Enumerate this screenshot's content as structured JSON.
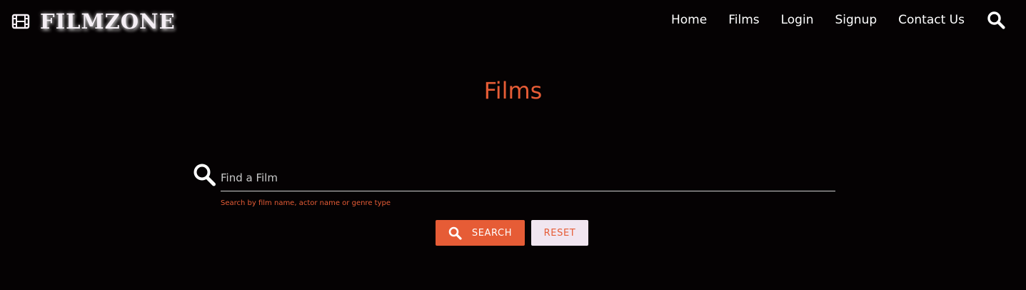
{
  "brand": {
    "name": "FILMZONE",
    "icon": "film-icon"
  },
  "nav": {
    "items": [
      "Home",
      "Films",
      "Login",
      "Signup",
      "Contact Us"
    ],
    "search_icon": "search-icon"
  },
  "page": {
    "title": "Films"
  },
  "search": {
    "placeholder": "Find a Film",
    "value": "",
    "helper": "Search by film name, actor name or genre type",
    "icon": "search-icon"
  },
  "buttons": {
    "search_label": "SEARCH",
    "reset_label": "RESET"
  },
  "colors": {
    "background": "#050203",
    "accent": "#e65c36",
    "reset_bg": "#f1e6f0",
    "text": "#ffffff"
  }
}
